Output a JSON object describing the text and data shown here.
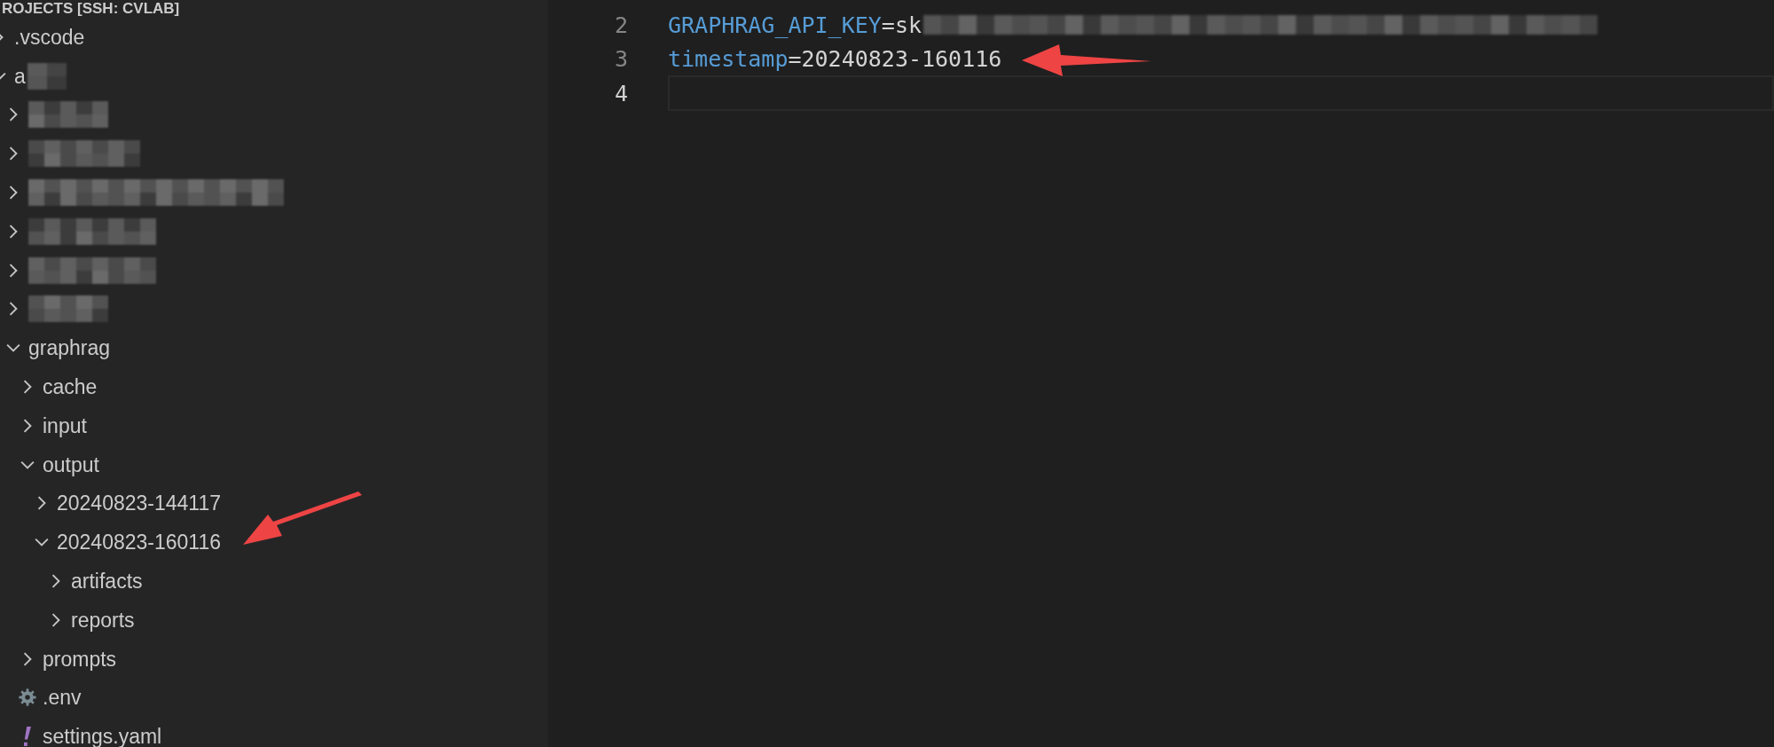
{
  "explorer": {
    "title": "ROJECTS [SSH: CVLAB]",
    "tree": [
      {
        "kind": "folder",
        "name": ".vscode",
        "expanded": false
      },
      {
        "kind": "folder",
        "name": "a",
        "redacted": true,
        "expanded": true,
        "children": [
          {
            "kind": "redacted",
            "expanded": false
          },
          {
            "kind": "redacted",
            "expanded": false
          },
          {
            "kind": "redacted",
            "expanded": false
          },
          {
            "kind": "redacted",
            "expanded": false
          },
          {
            "kind": "redacted",
            "expanded": false
          },
          {
            "kind": "redacted",
            "expanded": false
          },
          {
            "kind": "folder",
            "name": "graphrag",
            "expanded": true,
            "children": [
              {
                "kind": "folder",
                "name": "cache",
                "expanded": false
              },
              {
                "kind": "folder",
                "name": "input",
                "expanded": false
              },
              {
                "kind": "folder",
                "name": "output",
                "expanded": true,
                "children": [
                  {
                    "kind": "folder",
                    "name": "20240823-144117",
                    "expanded": false
                  },
                  {
                    "kind": "folder",
                    "name": "20240823-160116",
                    "expanded": true,
                    "children": [
                      {
                        "kind": "folder",
                        "name": "artifacts",
                        "expanded": false
                      },
                      {
                        "kind": "folder",
                        "name": "reports",
                        "expanded": false
                      }
                    ]
                  }
                ]
              },
              {
                "kind": "folder",
                "name": "prompts",
                "expanded": false
              },
              {
                "kind": "env",
                "name": ".env"
              },
              {
                "kind": "yaml",
                "name": "settings.yaml"
              }
            ]
          }
        ]
      }
    ]
  },
  "editor": {
    "lines": [
      {
        "number": "2",
        "current": false,
        "tokens": [
          {
            "kind": "key",
            "text": "GRAPHRAG_API_KEY"
          },
          {
            "kind": "plain",
            "text": "=sk"
          },
          {
            "kind": "redacted"
          }
        ]
      },
      {
        "number": "3",
        "current": false,
        "tokens": [
          {
            "kind": "key",
            "text": "timestamp"
          },
          {
            "kind": "plain",
            "text": "=20240823-160116"
          }
        ]
      },
      {
        "number": "4",
        "current": true
      }
    ]
  }
}
